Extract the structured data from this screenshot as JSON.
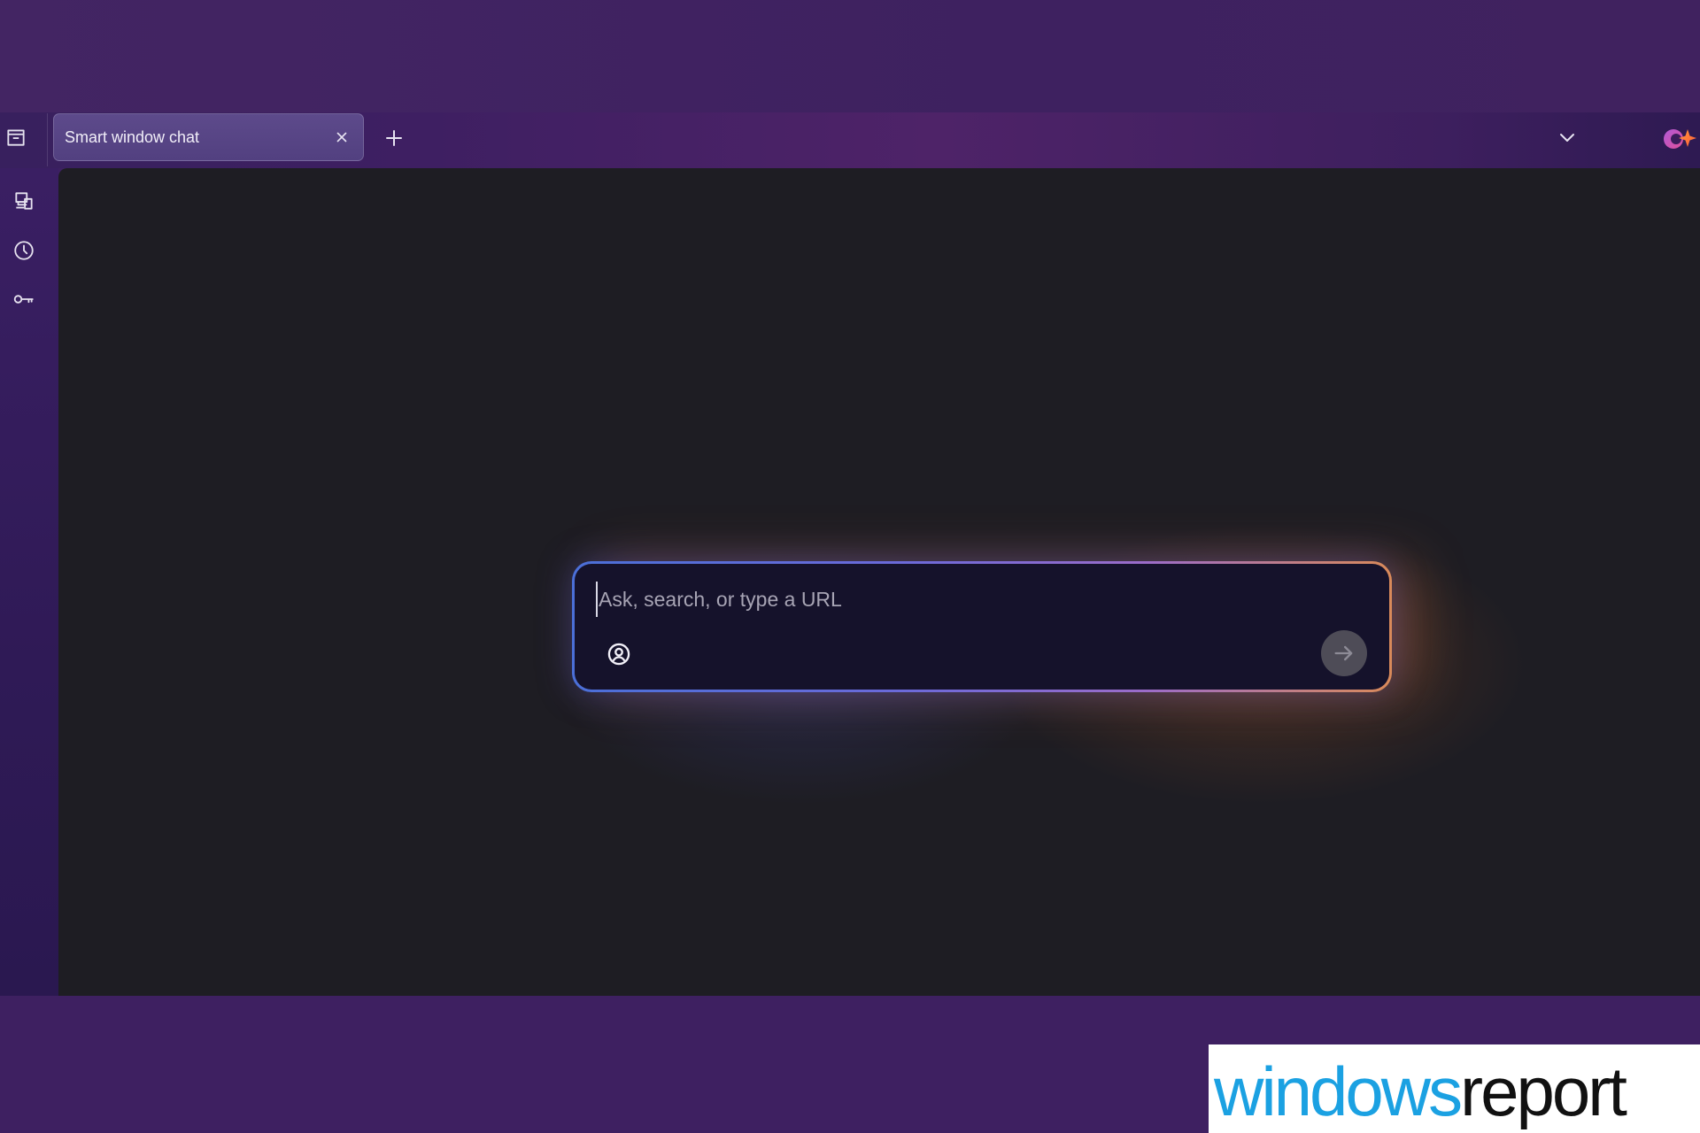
{
  "tabbar": {
    "tabs": [
      {
        "label": "Smart window chat",
        "active": true
      }
    ],
    "new_tab_icon": "plus-icon",
    "tab_list_icon": "chevron-down-icon",
    "brand_icon": "assistant-sparkle-icon"
  },
  "sidebar": {
    "items": [
      {
        "name": "tab-groups",
        "icon": "archive-box-icon"
      },
      {
        "name": "synced-devices",
        "icon": "devices-icon"
      },
      {
        "name": "history",
        "icon": "clock-icon"
      },
      {
        "name": "passwords",
        "icon": "key-icon"
      }
    ]
  },
  "prompt": {
    "placeholder": "Ask, search, or type a URL",
    "value": "",
    "persona_icon": "person-circle-icon",
    "submit_icon": "arrow-right-icon"
  },
  "watermark": {
    "text": "windowsreport"
  },
  "colors": {
    "frame_purple": "#3d2161",
    "content_bg": "#1e1d23",
    "prompt_bg": "#15122b",
    "prompt_border_start": "#4b6fd8",
    "prompt_border_end": "#d98a5a",
    "watermark_blue": "#1ba1e2"
  }
}
